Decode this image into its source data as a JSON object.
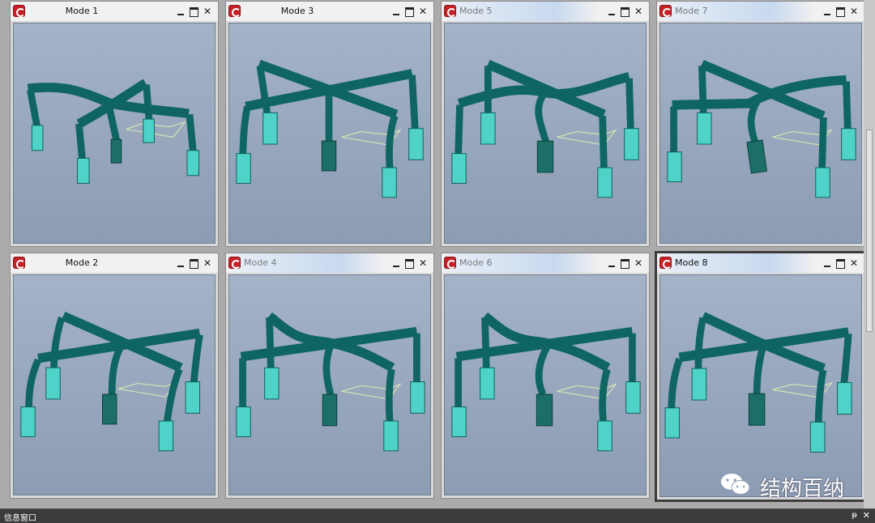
{
  "windows": [
    {
      "title": "Mode 1"
    },
    {
      "title": "Mode 2"
    },
    {
      "title": "Mode 3"
    },
    {
      "title": "Mode 4"
    },
    {
      "title": "Mode 5"
    },
    {
      "title": "Mode 6"
    },
    {
      "title": "Mode 7"
    },
    {
      "title": "Mode 8"
    }
  ],
  "window_controls": {
    "close_glyph": "✕"
  },
  "info_panel": {
    "title": "信息窗口",
    "pin_glyph": "ᵽ",
    "close_glyph": "✕"
  },
  "watermark": {
    "text": "结构百纳"
  },
  "colors": {
    "accent_teal": "#3ec9bf",
    "viewport_top": "#a4b3c7",
    "viewport_bottom": "#8c9cb3"
  }
}
